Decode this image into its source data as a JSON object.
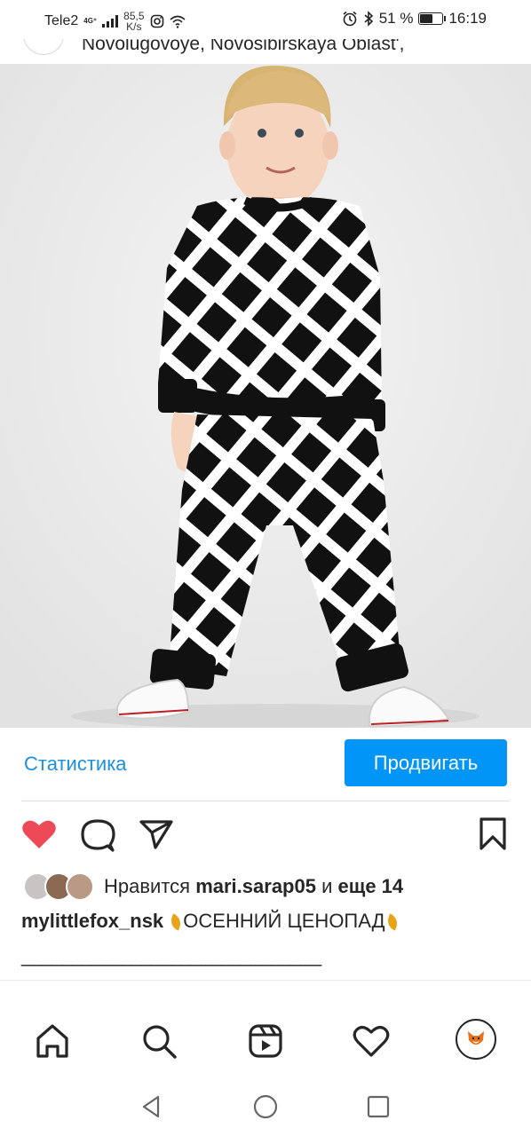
{
  "status_bar": {
    "carrier": "Tele2",
    "network": "4G⁺",
    "speed_value": "85,5",
    "speed_unit": "K/s",
    "battery_percent": "51 %",
    "battery_level": 0.51,
    "time": "16:19"
  },
  "post": {
    "location": "Novolugovoye, Novosibirskaya Oblast',",
    "stats_label": "Статистика",
    "promote_label": "Продвигать",
    "likes_prefix": "Нравится",
    "liked_by": "mari.sarap05",
    "likes_connector": "и",
    "likes_others": "еще 14",
    "caption_user": "mylittlefox_nsk",
    "caption_text": "ОСЕННИЙ ЦЕНОПАД",
    "caption_separator": "______________________________",
    "caption_cut_line": ""
  },
  "icons": {
    "like": "heart-filled-icon",
    "comment": "comment-icon",
    "share": "paper-plane-icon",
    "save": "bookmark-icon",
    "home": "home-icon",
    "search": "search-icon",
    "reels": "reels-icon",
    "activity": "heart-outline-icon",
    "profile": "profile-fox-icon",
    "back": "back-triangle-icon",
    "system_home": "circle-home-icon",
    "recents": "square-recents-icon"
  },
  "colors": {
    "like_red": "#ed4956",
    "link_blue": "#1a8fe3",
    "button_blue": "#0095f6",
    "leaf_orange": "#e8a317"
  }
}
